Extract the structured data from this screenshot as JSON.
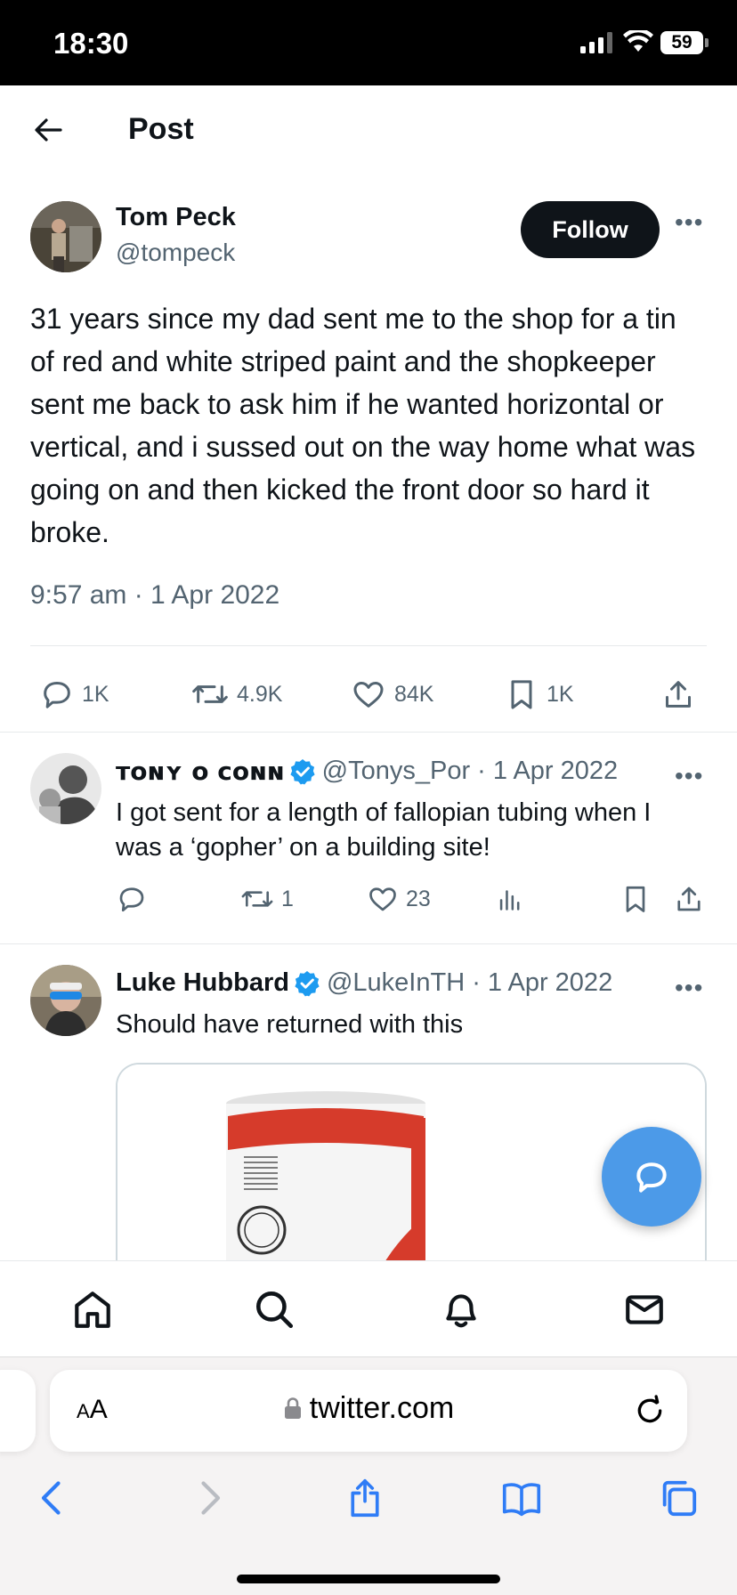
{
  "status_bar": {
    "time": "18:30",
    "battery": "59"
  },
  "header": {
    "title": "Post"
  },
  "main_tweet": {
    "author_name": "Tom Peck",
    "author_handle": "@tompeck",
    "follow_label": "Follow",
    "text": "31 years since my dad sent me to the shop for a tin of red and white striped paint and the shopkeeper sent me back to ask him if he wanted horizontal or vertical, and i sussed out on the way home what was going on and then kicked the front door so hard it broke.",
    "timestamp": "9:57 am · 1 Apr 2022",
    "stats": {
      "replies": "1K",
      "reposts": "4.9K",
      "likes": "84K",
      "bookmarks": "1K"
    }
  },
  "replies": [
    {
      "author_name": "ᴛᴏɴʏ ᴏ ᴄᴏɴɴ",
      "handle_date": "@Tonys_Por · 1 Apr 2022",
      "text": "I got sent for a length of fallopian tubing when I was a ‘gopher’ on a building site!",
      "stats": {
        "replies": "",
        "reposts": "1",
        "likes": "23"
      }
    },
    {
      "author_name": "Luke Hubbard",
      "handle_date": "@LukeInTH · 1 Apr 2022",
      "text": "Should have returned with this"
    }
  ],
  "browser": {
    "url": "twitter.com",
    "aa_label_small": "A",
    "aa_label_big": "A"
  },
  "colors": {
    "accent": "#1d9bf0",
    "fab": "#4c9ae8",
    "text": "#0f1419",
    "muted": "#536471"
  }
}
